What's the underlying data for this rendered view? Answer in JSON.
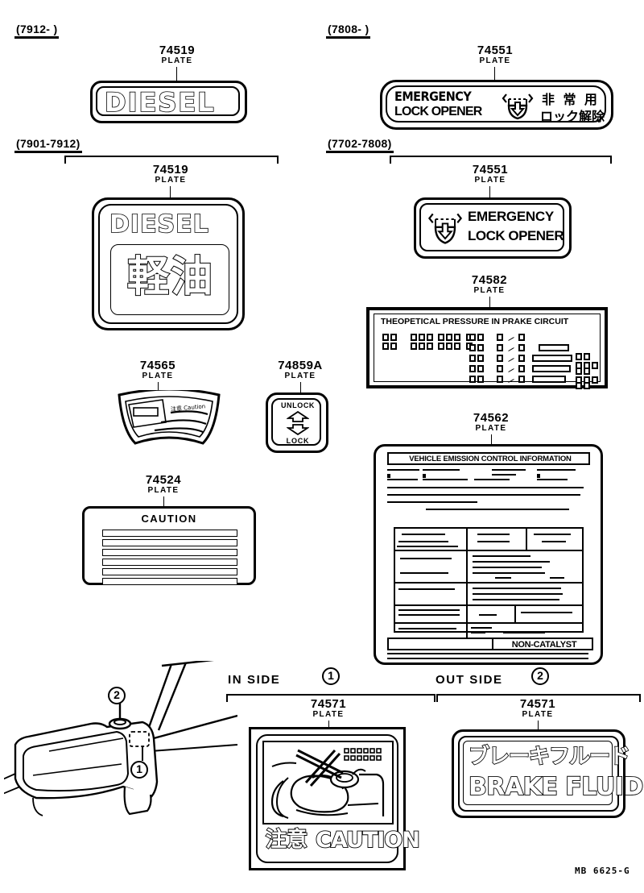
{
  "page": {
    "footer_code": "MB 6625-G"
  },
  "sections": [
    {
      "id": "diesel-new",
      "range_label": "(7912-          )",
      "part_number": "74519",
      "part_sub": "PLATE",
      "plate_text": "DIESEL"
    },
    {
      "id": "emergency-new",
      "range_label": "(7808-          )",
      "part_number": "74551",
      "part_sub": "PLATE",
      "line1_en": "EMERGENCY",
      "line2_en": "LOCK OPENER",
      "line1_jp": "非  常  用",
      "line2_jp": "ロック解除"
    },
    {
      "id": "diesel-old",
      "range_label": "(7901-7912)",
      "part_number": "74519",
      "part_sub": "PLATE",
      "plate_text": "DIESEL",
      "plate_text_jp": "軽油"
    },
    {
      "id": "emergency-old",
      "range_label": "(7702-7808)",
      "part_number": "74551",
      "part_sub": "PLATE",
      "line1_en": "EMERGENCY",
      "line2_en": "LOCK OPENER"
    }
  ],
  "arc_plate": {
    "part_number": "74565",
    "part_sub": "PLATE",
    "micro_text": "注意 Caution"
  },
  "lock_plate": {
    "part_number": "74859A",
    "part_sub": "PLATE",
    "top_label": "UNLOCK",
    "bottom_label": "LOCK",
    "up_arrow_icon": "arrow-up",
    "down_arrow_icon": "arrow-down"
  },
  "caution_plate": {
    "part_number": "74524",
    "part_sub": "PLATE",
    "title": "CAUTION",
    "line_count": 6
  },
  "pressure_plate": {
    "part_number": "74582",
    "part_sub": "PLATE",
    "title": "THEOPETICAL  PRESSURE  IN  PRAKE  CIRCUIT"
  },
  "emission_plate": {
    "part_number": "74562",
    "part_sub": "PLATE",
    "title": "VEHICLE   EMISSION   CONTROL   INFORMATION",
    "badge": "NON-CATALYST"
  },
  "bottom": {
    "in_side_label": "IN SIDE",
    "in_side_callout": "1",
    "out_side_label": "OUT SIDE",
    "out_side_callout": "2",
    "in_plate": {
      "part_number": "74571",
      "part_sub": "PLATE",
      "caption_jp": "注意",
      "caption_en": "CAUTION",
      "illustration": "jack-crossed-out"
    },
    "out_plate": {
      "part_number": "74571",
      "part_sub": "PLATE",
      "text_jp": "ブレーキフルード",
      "text_en": "BRAKE FLUID"
    },
    "vehicle_view": {
      "callout_1": "1",
      "callout_2": "2",
      "illustration": "door-interior-perspective"
    }
  }
}
